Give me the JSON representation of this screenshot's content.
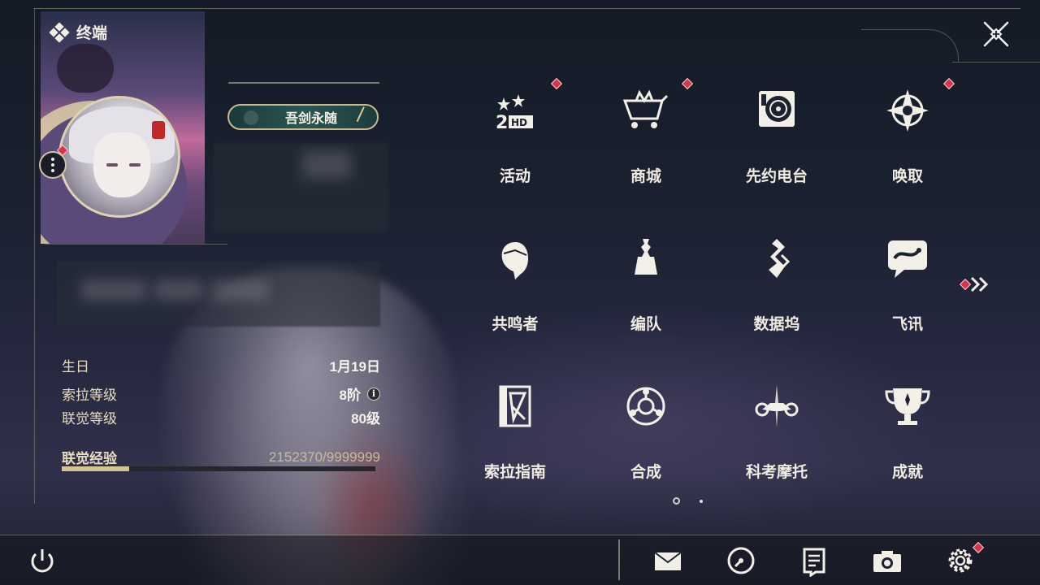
{
  "header": {
    "title": "终端"
  },
  "profile": {
    "nameplate": "吾剑永随",
    "birthday_label": "生日",
    "birthday_value": "1月19日",
    "sola_label": "索拉等级",
    "sola_value": "8阶",
    "union_label": "联觉等级",
    "union_value": "80级",
    "exp_label": "联觉经验",
    "exp_value": "2152370/9999999",
    "exp_progress": 0.2152
  },
  "menu": {
    "items": [
      {
        "label": "活动",
        "icon": "event-icon",
        "badge": true
      },
      {
        "label": "商城",
        "icon": "shop-cart-icon",
        "badge": true
      },
      {
        "label": "先约电台",
        "icon": "radio-disc-icon",
        "badge": false
      },
      {
        "label": "唤取",
        "icon": "convene-star-icon",
        "badge": true
      },
      {
        "label": "共鸣者",
        "icon": "resonator-head-icon",
        "badge": false
      },
      {
        "label": "编队",
        "icon": "chess-team-icon",
        "badge": false
      },
      {
        "label": "数据坞",
        "icon": "data-bank-icon",
        "badge": false
      },
      {
        "label": "飞讯",
        "icon": "message-chat-icon",
        "badge": false
      },
      {
        "label": "索拉指南",
        "icon": "guidebook-icon",
        "badge": false
      },
      {
        "label": "合成",
        "icon": "synthesis-icon",
        "badge": false
      },
      {
        "label": "科考摩托",
        "icon": "motorcycle-icon",
        "badge": false
      },
      {
        "label": "成就",
        "icon": "trophy-icon",
        "badge": false
      }
    ]
  },
  "bottom_bar": {
    "icons": [
      "power-icon",
      "mail-icon",
      "clock-icon",
      "notice-icon",
      "camera-icon",
      "settings-icon"
    ]
  },
  "colors": {
    "accent": "#d8c38f",
    "badge": "#d8344a",
    "text": "#f1ece2"
  }
}
